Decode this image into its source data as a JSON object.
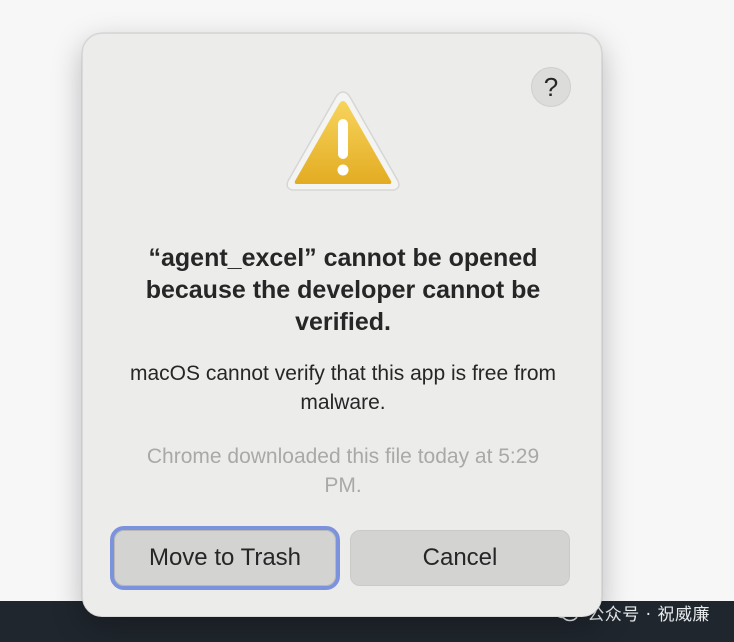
{
  "dialog": {
    "help_label": "?",
    "icon": "warning-icon",
    "title": "“agent_excel” cannot be opened because the developer cannot be verified.",
    "message": "macOS cannot verify that this app is free from malware.",
    "info": "Chrome downloaded this file today at 5:29 PM.",
    "buttons": {
      "move_to_trash": "Move to Trash",
      "cancel": "Cancel"
    }
  },
  "watermark": {
    "text": "公众号 · 祝威廉",
    "icon": "wechat-icon"
  },
  "colors": {
    "dialog_bg": "#ececeb",
    "focus_ring": "#7c92dc",
    "warning_yellow": "#f1c232",
    "bottom_bar": "#1f262d"
  }
}
